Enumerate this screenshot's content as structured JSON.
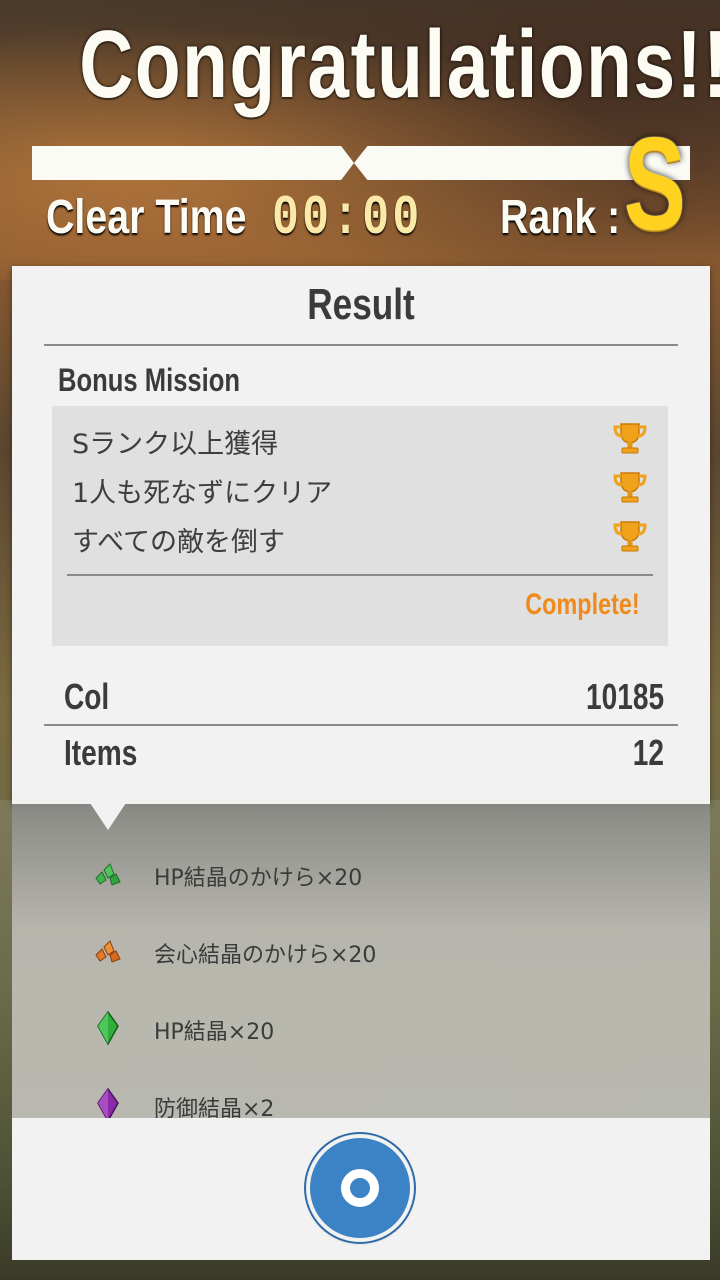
{
  "header": {
    "title": "Congratulations!!",
    "clear_time_label": "Clear Time",
    "clear_time_value": "00:00",
    "rank_label": "Rank :",
    "rank_value": "S"
  },
  "result": {
    "title": "Result",
    "bonus_mission_title": "Bonus Mission",
    "missions": [
      {
        "label": "Sランク以上獲得",
        "icon": "trophy-icon"
      },
      {
        "label": "1人も死なずにクリア",
        "icon": "trophy-icon"
      },
      {
        "label": "すべての敵を倒す",
        "icon": "trophy-icon"
      }
    ],
    "complete_label": "Complete!",
    "col_label": "Col",
    "col_value": "10185",
    "items_label": "Items",
    "items_value": "12"
  },
  "items": [
    {
      "label": "HP結晶のかけら×20",
      "icon": "green-crystal-shard-icon"
    },
    {
      "label": "会心結晶のかけら×20",
      "icon": "orange-crystal-shard-icon"
    },
    {
      "label": "HP結晶×20",
      "icon": "green-crystal-icon"
    },
    {
      "label": "防御結晶×2",
      "icon": "purple-crystal-icon"
    }
  ],
  "footer": {
    "ok_button_icon": "circle-ok-icon"
  },
  "colors": {
    "accent_orange": "#f08a1a",
    "rank_gold": "#ffd21f",
    "button_blue": "#3c83c6"
  }
}
